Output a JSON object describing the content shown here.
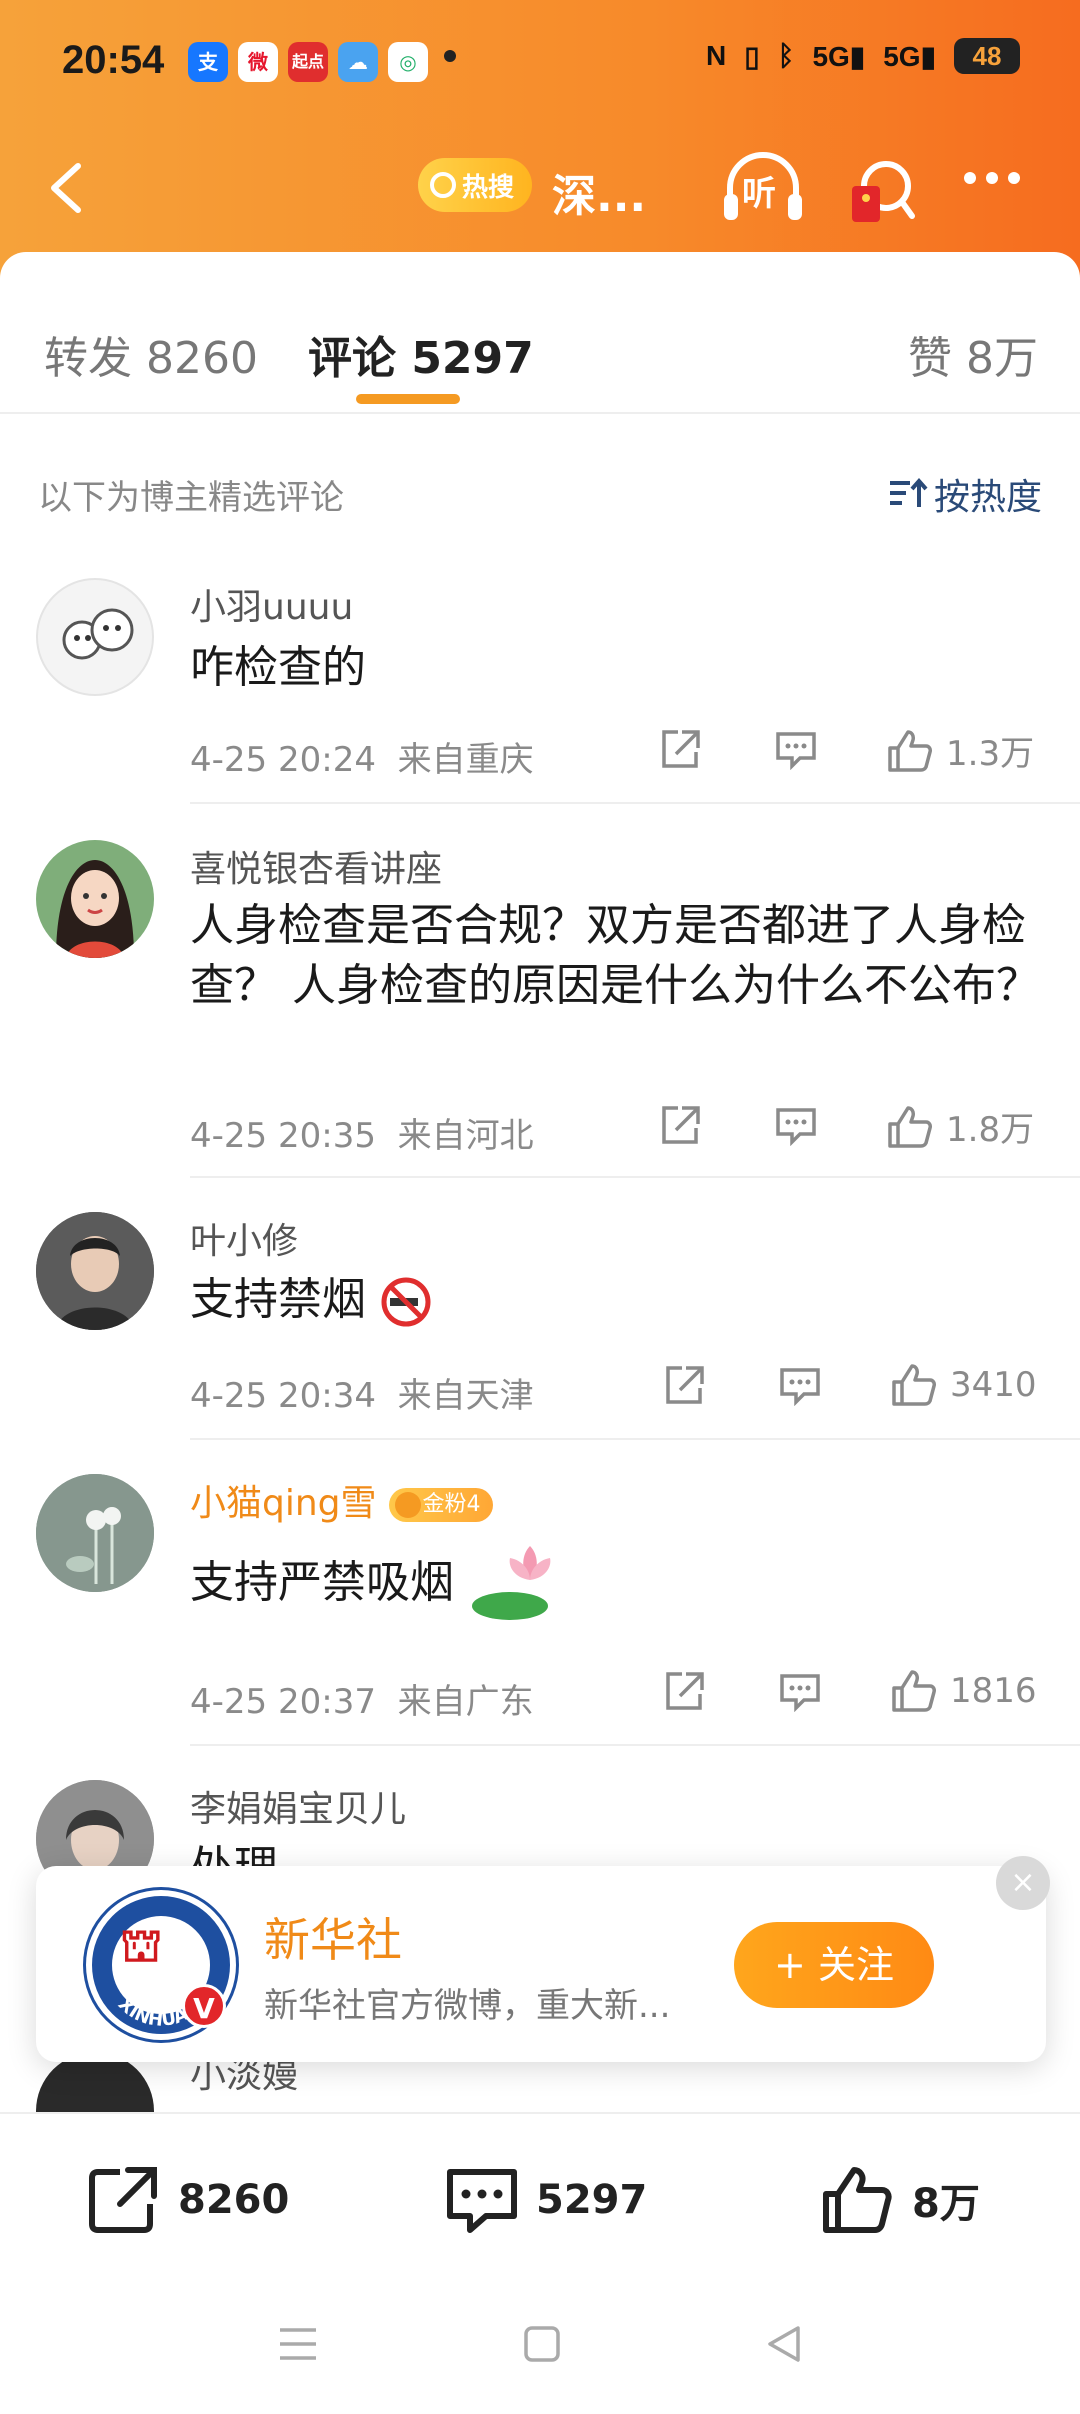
{
  "status_bar": {
    "time": "20:54",
    "network": "5G",
    "network2": "5G",
    "battery": "48",
    "app_icons": [
      {
        "name": "alipay-icon",
        "glyph": "支",
        "color": "#1677ff"
      },
      {
        "name": "weibo-icon",
        "glyph": "微",
        "color": "#ffb800"
      },
      {
        "name": "qidian-icon",
        "glyph": "起点",
        "color": "#e02e2e"
      },
      {
        "name": "weather-icon",
        "glyph": "☁",
        "color": "#4aa3f0"
      },
      {
        "name": "app-icon",
        "glyph": "◎",
        "color": "#23b06b"
      }
    ]
  },
  "nav": {
    "hot_label": "热搜",
    "title": "深...",
    "listen_label": "听"
  },
  "tabs": {
    "repost": "转发 8260",
    "comments": "评论 5297",
    "likes": "赞 8万"
  },
  "section": {
    "heading": "以下为博主精选评论",
    "sort_label": "按热度"
  },
  "comments": [
    {
      "user": "小羽uuuu",
      "text": "咋检查的",
      "time": "4-25 20:24",
      "location": "来自重庆",
      "likes": "1.3万"
    },
    {
      "user": "喜悦银杏看讲座",
      "text": "人身检查是否合规？双方是否都进了人身检查？ 人身检查的原因是什么为什么不公布？",
      "time": "4-25 20:35",
      "location": "来自河北",
      "likes": "1.8万"
    },
    {
      "user": "叶小修",
      "text": "支持禁烟",
      "time": "4-25 20:34",
      "location": "来自天津",
      "likes": "3410"
    },
    {
      "user": "小猫qing雪",
      "badge": "金粉4",
      "text": "支持严禁吸烟",
      "time": "4-25 20:37",
      "location": "来自广东",
      "likes": "1816"
    },
    {
      "user": "李娟娟宝贝儿",
      "text": "处理"
    },
    {
      "user": "小淡嫚"
    }
  ],
  "follow_popup": {
    "name": "新华社",
    "description": "新华社官方微博，重大新...",
    "follow_label": "+ 关注",
    "close_glyph": "×",
    "verified_glyph": "V",
    "logo_text": "XINHUA"
  },
  "bottom_bar": {
    "repost_count": "8260",
    "comment_count": "5297",
    "like_count": "8万"
  },
  "colors": {
    "header_start": "#f6a23a",
    "header_end": "#f66c1f",
    "accent": "#f59a22",
    "gold_name": "#f08a18"
  }
}
